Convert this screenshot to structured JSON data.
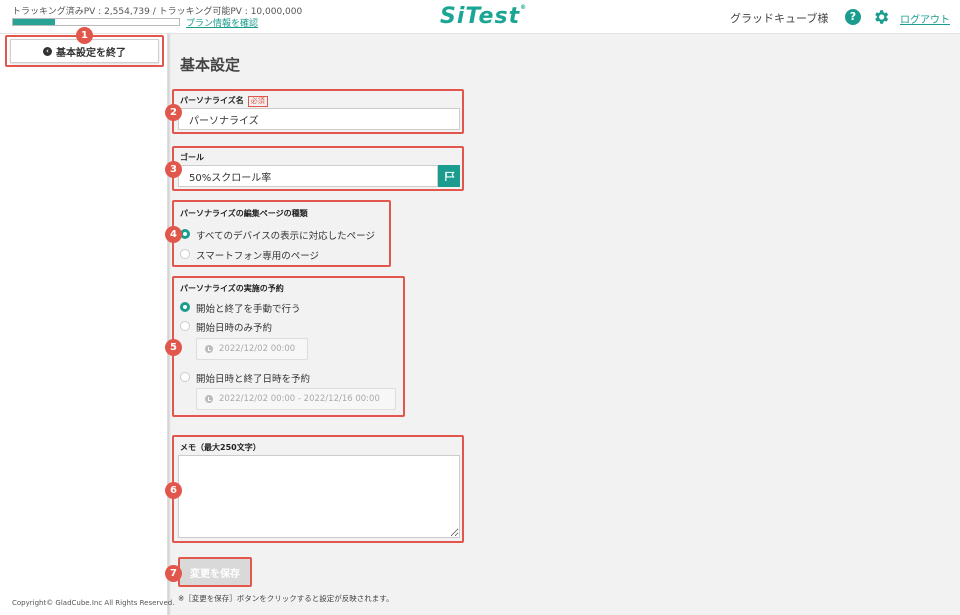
{
  "header": {
    "pv_text": "トラッキング済みPV : 2,554,739  /  トラッキング可能PV : 10,000,000",
    "pv_progress_fraction": 0.2555,
    "plan_link": "プラン情報を確認",
    "logo": "SiTest",
    "logo_mark": "®",
    "user_name": "グラッドキューブ様",
    "help_icon": "?",
    "logout": "ログアウト"
  },
  "sidebar": {
    "exit_button": "基本設定を終了",
    "copyright": "Copyright© GladCube.Inc All Rights Reserved."
  },
  "badges": [
    "1",
    "2",
    "3",
    "4",
    "5",
    "6",
    "7"
  ],
  "main": {
    "title": "基本設定",
    "name_field": {
      "label": "パーソナライズ名",
      "required": "必須",
      "value": "パーソナライズ"
    },
    "goal_field": {
      "label": "ゴール",
      "value": "50%スクロール率"
    },
    "edit_page": {
      "label": "パーソナライズの編集ページの種類",
      "options": [
        "すべてのデバイスの表示に対応したページ",
        "スマートフォン専用のページ"
      ],
      "selected": 0
    },
    "schedule": {
      "label": "パーソナライズの実施の予約",
      "options": [
        "開始と終了を手動で行う",
        "開始日時のみ予約",
        "開始日時と終了日時を予約"
      ],
      "selected": 0,
      "start_only_value": "2022/12/02 00:00",
      "range_value": "2022/12/02 00:00 - 2022/12/16 00:00"
    },
    "memo": {
      "label": "メモ（最大250文字）",
      "value": ""
    },
    "save_button": "変更を保存",
    "save_note": "※［変更を保存］ボタンをクリックすると設定が反映されます。"
  },
  "colors": {
    "accent": "#1a9c8e",
    "highlight": "#e2574c"
  }
}
